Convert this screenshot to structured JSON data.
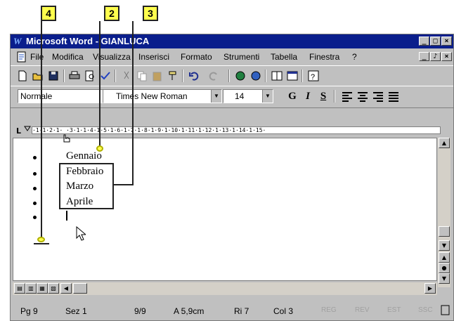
{
  "callouts": [
    "4",
    "2",
    "3"
  ],
  "window": {
    "app_letter": "W",
    "title": "Microsoft Word - GIANLUCA",
    "controls": [
      "_",
      "□",
      "×"
    ]
  },
  "menubar": {
    "items": [
      "File",
      "Modifica",
      "Visualizza",
      "Inserisci",
      "Formato",
      "Strumenti",
      "Tabella",
      "Finestra",
      "?"
    ],
    "doc_controls": [
      "_",
      "♪",
      "×"
    ]
  },
  "standard_toolbar": {
    "buttons": [
      "new-document",
      "open-folder",
      "save",
      "print",
      "print-preview",
      "spelling",
      "cut",
      "copy",
      "paste",
      "format-painter",
      "undo",
      "redo",
      "insert-hyperlink",
      "web-toolbar",
      "columns",
      "table",
      "help"
    ]
  },
  "format_toolbar": {
    "style": "Normale",
    "font": "Times New Roman",
    "size": "14",
    "bold": "G",
    "italic": "I",
    "underline": "S"
  },
  "ruler": {
    "text": "·1·1·2·1· ·3·1·1·4·1·5·1·6·1·7·1·8·1·9·1·10·1·11·1·12·1·13·1·14·1·15·"
  },
  "document": {
    "lines": [
      "Gennaio",
      "Febbraio",
      "Marzo",
      "Aprile"
    ]
  },
  "status_bar": {
    "page": "Pg 9",
    "section": "Sez 1",
    "pages": "9/9",
    "position": "A 5,9cm",
    "line": "Ri 7",
    "column": "Col 3",
    "modes": [
      "REG",
      "REV",
      "EST",
      "SSC"
    ]
  }
}
